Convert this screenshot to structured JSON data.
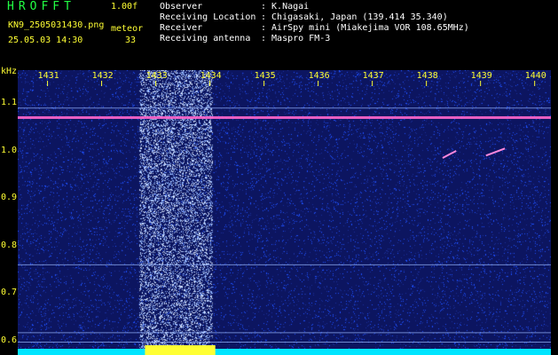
{
  "header": {
    "app_title": "HROFFT",
    "version": "1.00f",
    "filename": "KN9_2505031430.png",
    "meteor_label": "meteor",
    "timestamp": "25.05.03 14:30",
    "meteor_count": "33",
    "info": [
      {
        "key": "Observer",
        "value": ": K.Nagai"
      },
      {
        "key": "Receiving Location",
        "value": ": Chigasaki, Japan (139.414 35.340)"
      },
      {
        "key": "Receiver",
        "value": ": AirSpy mini (Miakejima VOR 108.65MHz)"
      },
      {
        "key": "Receiving antenna",
        "value": ": Maspro FM-3"
      }
    ]
  },
  "chart_data": {
    "type": "heatmap",
    "title": "",
    "ylabel": "kHz",
    "x_ticks": [
      "1431",
      "1432",
      "1433",
      "1434",
      "1435",
      "1436",
      "1437",
      "1438",
      "1439",
      "1440"
    ],
    "y_ticks": [
      "1.1",
      "1.0",
      "0.9",
      "0.8",
      "0.7",
      "0.6"
    ],
    "ylim": [
      0.57,
      1.17
    ],
    "horizontal_lines": [
      1.07,
      1.09,
      0.76,
      0.617,
      0.597
    ],
    "meteor_echoes": [
      {
        "x": [
          1438.3,
          1438.55
        ],
        "y": [
          0.985,
          1.0
        ]
      },
      {
        "x": [
          1439.1,
          1439.45
        ],
        "y": [
          0.99,
          1.005
        ]
      }
    ],
    "colors": {
      "background": "#0c1560",
      "noise": "#1e50ff",
      "signal": "#b0d0ff",
      "carrier": "#ff66cc",
      "baseline": "#00e5ff",
      "label": "#ffff33"
    }
  }
}
